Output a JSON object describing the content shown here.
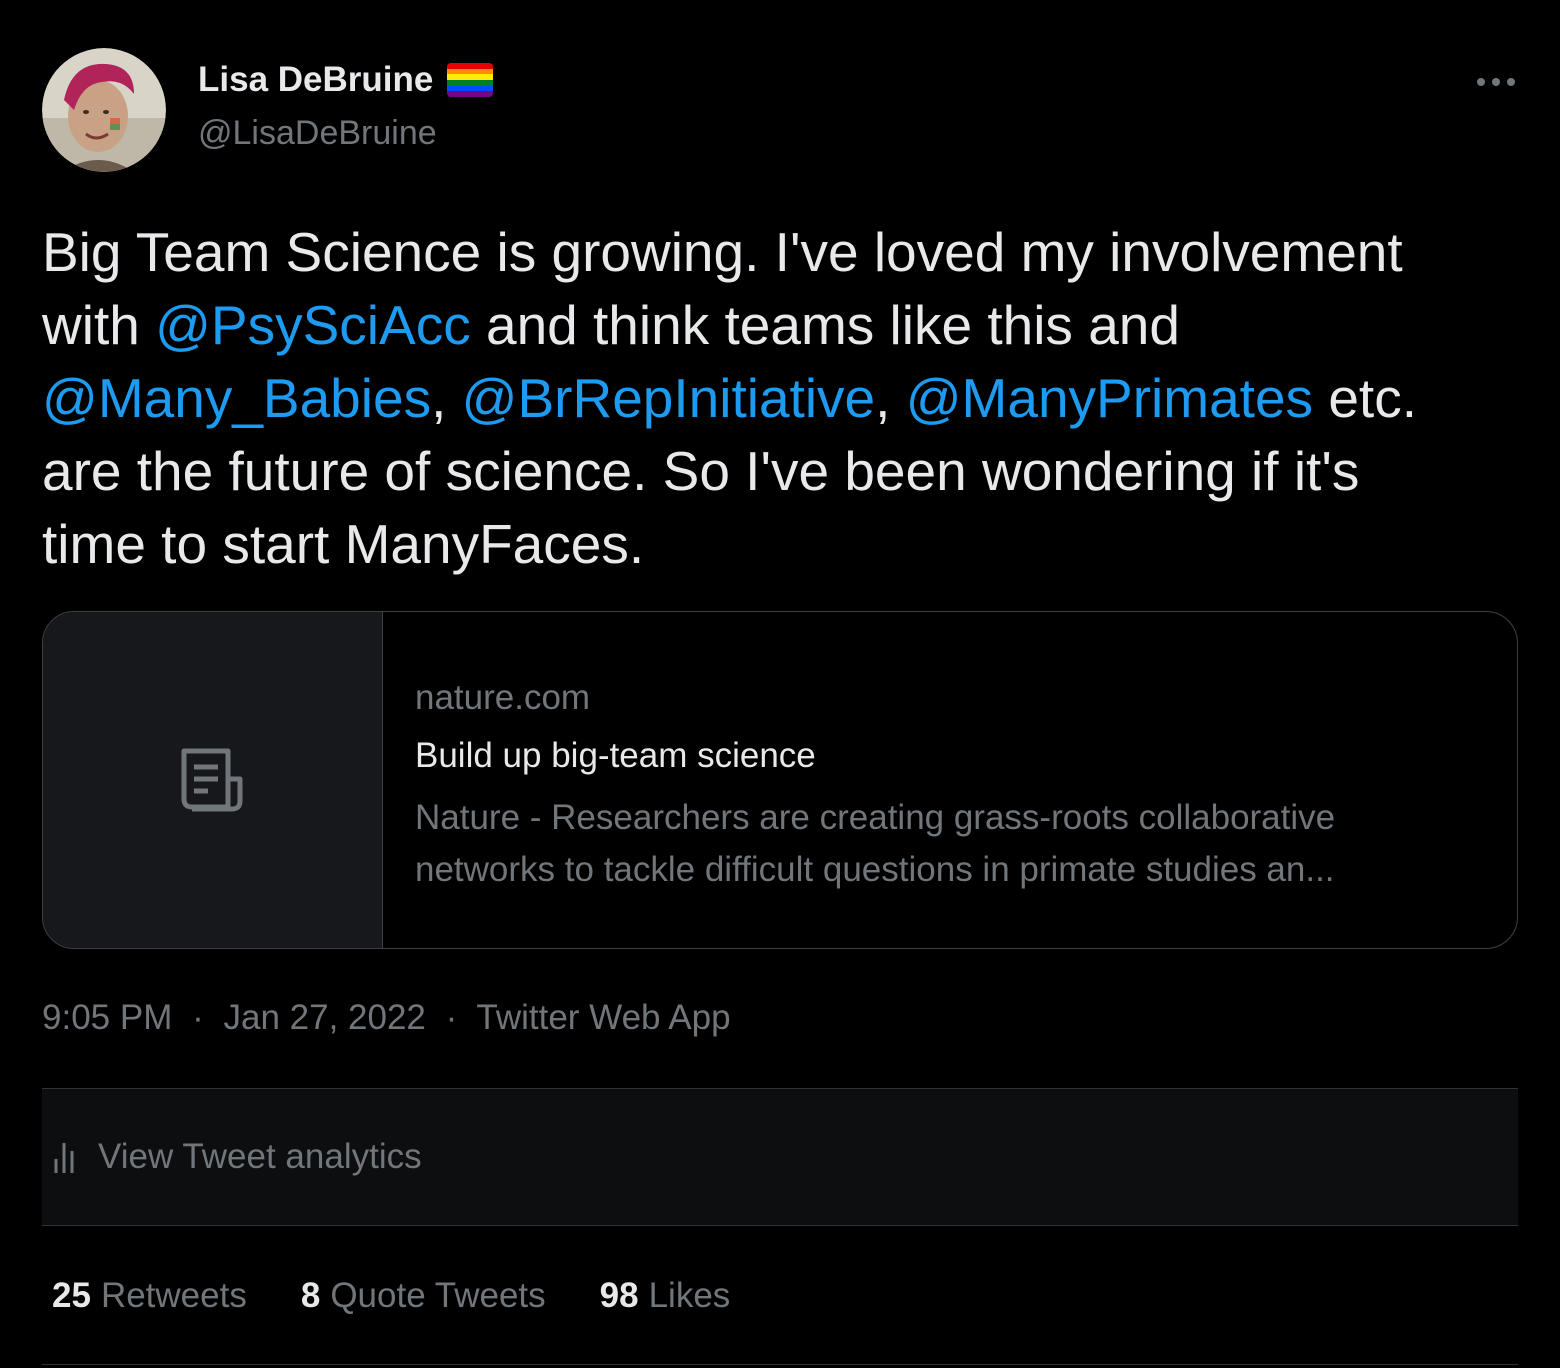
{
  "author": {
    "name": "Lisa DeBruine",
    "handle": "@LisaDeBruine",
    "name_emoji": "rainbow-flag"
  },
  "tweet": {
    "lines": [
      [
        {
          "text": "Big Team Science is growing. I've loved my involvement",
          "mention": false
        }
      ],
      [
        {
          "text": "with ",
          "mention": false
        },
        {
          "text": "@PsySciAcc",
          "mention": true
        },
        {
          "text": " and think teams like this and",
          "mention": false
        }
      ],
      [
        {
          "text": "@Many_Babies",
          "mention": true
        },
        {
          "text": ", ",
          "mention": false
        },
        {
          "text": "@BrRepInitiative",
          "mention": true
        },
        {
          "text": ", ",
          "mention": false
        },
        {
          "text": "@ManyPrimates",
          "mention": true
        },
        {
          "text": " etc.",
          "mention": false
        }
      ],
      [
        {
          "text": "are the future of science. So I've been wondering if it's",
          "mention": false
        }
      ],
      [
        {
          "text": "time to start ManyFaces.",
          "mention": false
        }
      ]
    ]
  },
  "card": {
    "icon": "article-icon",
    "domain": "nature.com",
    "title": "Build up big-team science",
    "description_lines": [
      "Nature - Researchers are creating grass-roots collaborative",
      "networks to tackle difficult questions in primate studies an..."
    ]
  },
  "meta": {
    "time": "9:05 PM",
    "separator": "·",
    "date": "Jan 27, 2022",
    "source": "Twitter Web App"
  },
  "analytics": {
    "label": "View Tweet analytics",
    "icon": "analytics-icon"
  },
  "stats": {
    "retweets": {
      "count": "25",
      "label": "Retweets"
    },
    "quotes": {
      "count": "8",
      "label": "Quote Tweets"
    },
    "likes": {
      "count": "98",
      "label": "Likes"
    }
  },
  "colors": {
    "background": "#000000",
    "text": "#e7e9ea",
    "secondary": "#71767b",
    "link": "#1d9bf0",
    "border": "#2f3336"
  }
}
